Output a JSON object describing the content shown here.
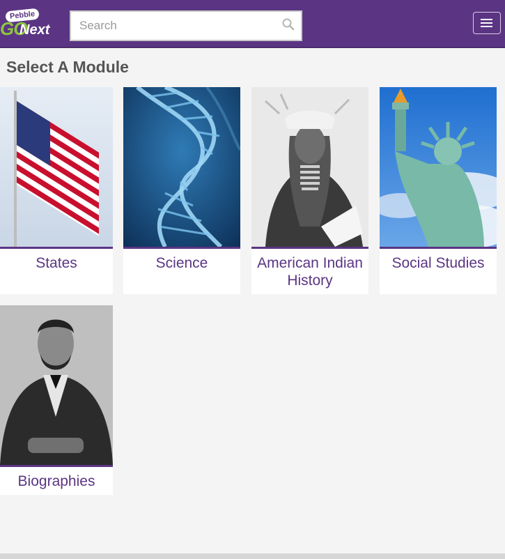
{
  "header": {
    "logo_top": "Pebble",
    "logo_go": "GO",
    "logo_next": "Next",
    "search": {
      "placeholder": "Search",
      "value": ""
    }
  },
  "main": {
    "title": "Select A Module",
    "modules": [
      {
        "label": "States",
        "image": "american-flag"
      },
      {
        "label": "Science",
        "image": "dna-helix"
      },
      {
        "label": "American Indian History",
        "image": "native-american-portrait"
      },
      {
        "label": "Social Studies",
        "image": "statue-of-liberty"
      },
      {
        "label": "Biographies",
        "image": "lincoln-portrait"
      }
    ]
  },
  "colors": {
    "brand": "#5b3583",
    "logo_green": "#8cc63f",
    "background": "#f4f4f4"
  }
}
